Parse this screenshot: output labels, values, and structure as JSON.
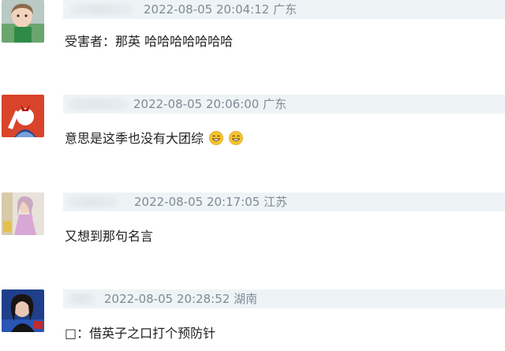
{
  "comments": [
    {
      "meta": "2022-08-05 20:04:12 广东",
      "text": "受害者：那英 哈哈哈哈哈哈哈"
    },
    {
      "meta": "2022-08-05 20:06:00 广东",
      "text": "意思是这季也没有大团综",
      "emojis": [
        "grin-emoji",
        "grin-emoji"
      ]
    },
    {
      "meta": "2022-08-05 20:17:05 江苏",
      "text": "又想到那句名言"
    },
    {
      "meta": "2022-08-05 20:28:52 湖南",
      "text": "□：借英子之口打个预防针"
    }
  ],
  "colors": {
    "meta_bar_bg": "#eef4f6",
    "meta_text": "#7f8a96",
    "comment_text": "#222222",
    "emoji_face": "#f4c430"
  }
}
